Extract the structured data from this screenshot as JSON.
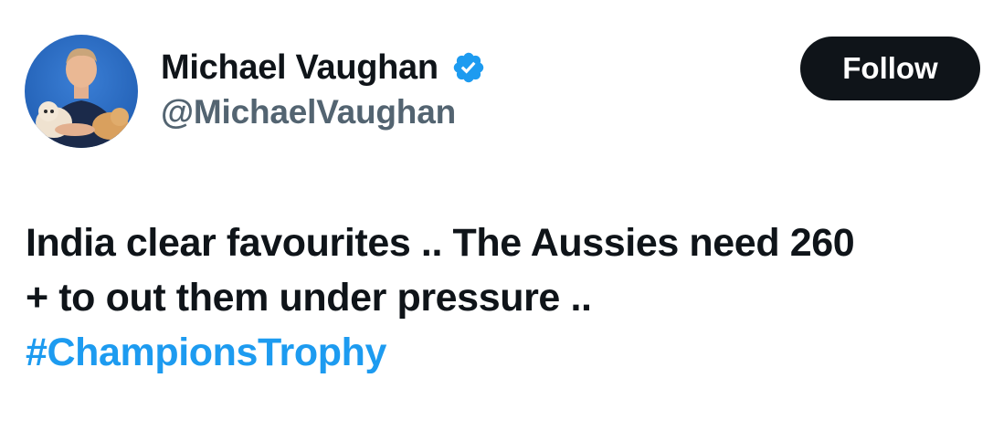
{
  "author": {
    "display_name": "Michael Vaughan",
    "handle": "@MichaelVaughan",
    "verified": true,
    "avatar_icon": "profile-photo-man-holding-dog"
  },
  "actions": {
    "follow_label": "Follow"
  },
  "tweet": {
    "lines": [
      "India clear favourites .. The Aussies need 260",
      "+ to out them under pressure .."
    ],
    "hashtag": "#ChampionsTrophy"
  },
  "colors": {
    "text": "#0f1419",
    "secondary": "#536471",
    "link": "#1d9bf0",
    "verified": "#1d9bf0",
    "button_bg": "#0f1419",
    "button_text": "#ffffff"
  }
}
